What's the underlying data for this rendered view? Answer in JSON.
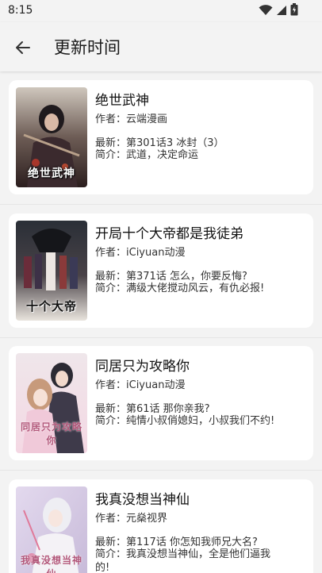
{
  "status_bar": {
    "time": "8:15",
    "icons": [
      "wifi-icon",
      "signal-icon",
      "battery-icon"
    ]
  },
  "app_bar": {
    "back_icon": "back-arrow-icon",
    "title": "更新时间"
  },
  "comics": [
    {
      "title": "绝世武神",
      "author": "作者：云端漫画",
      "latest": "最新：第301话3 冰封（3）",
      "summary": "简介：武道，决定命运",
      "cover_text": "绝世武神"
    },
    {
      "title": "开局十个大帝都是我徒弟",
      "author": "作者：iCiyuan动漫",
      "latest": "最新：第371话 怎么，你要反悔?",
      "summary": "简介：满级大佬搅动风云，有仇必报!",
      "cover_text": "十个大帝"
    },
    {
      "title": "同居只为攻略你",
      "author": "作者：iCiyuan动漫",
      "latest": "最新：第61话 那你亲我?",
      "summary": "简介：纯情小叔俏媳妇，小叔我们不约!",
      "cover_text": "同居只为攻略你"
    },
    {
      "title": "我真没想当神仙",
      "author": "作者：元燊视界",
      "latest": "最新：第117话 你怎知我师兄大名?",
      "summary": "简介：我真没想当神仙，全是他们逼我的!",
      "cover_text": "我真没想当神仙"
    }
  ],
  "colors": {
    "background": "#f3f3f3",
    "card": "#ffffff",
    "text": "#1a1a1a"
  }
}
